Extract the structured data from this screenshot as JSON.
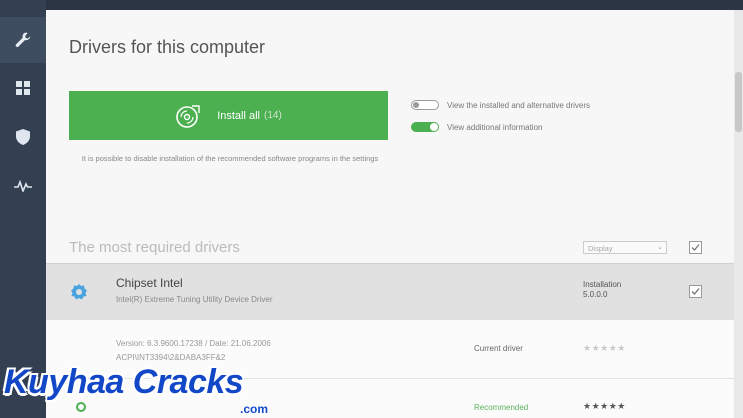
{
  "page": {
    "title": "Drivers for this computer"
  },
  "install": {
    "label": "Install all",
    "count": "(14)",
    "note": "It is possible to disable installation of the recommended software programs in the settings"
  },
  "toggles": [
    {
      "label": "View the installed and alternative drivers",
      "on": false
    },
    {
      "label": "View additional information",
      "on": true
    }
  ],
  "section": {
    "title": "The most required drivers",
    "select_value": "Display"
  },
  "driver": {
    "name": "Chipset Intel",
    "description": "Intel(R) Extreme Tuning Utility Device Driver",
    "status_label": "Installation",
    "status_version": "5.0.0.0"
  },
  "detail": {
    "version": "Version: 6.3.9600.17238 / Date: 21.06.2006",
    "hwid": "ACPI\\INT3394\\2&DABA3FF&2",
    "current_label": "Current driver",
    "current_stars": "★★★★★"
  },
  "alternative": {
    "recommended_label": "Recommended",
    "stars": "★★★★★"
  },
  "watermark": {
    "brand": "Kuyhaa Cracks",
    "suffix": ".com"
  },
  "colors": {
    "accent": "#4caf50",
    "sidebar": "#334052",
    "watermark": "#1248c8"
  }
}
